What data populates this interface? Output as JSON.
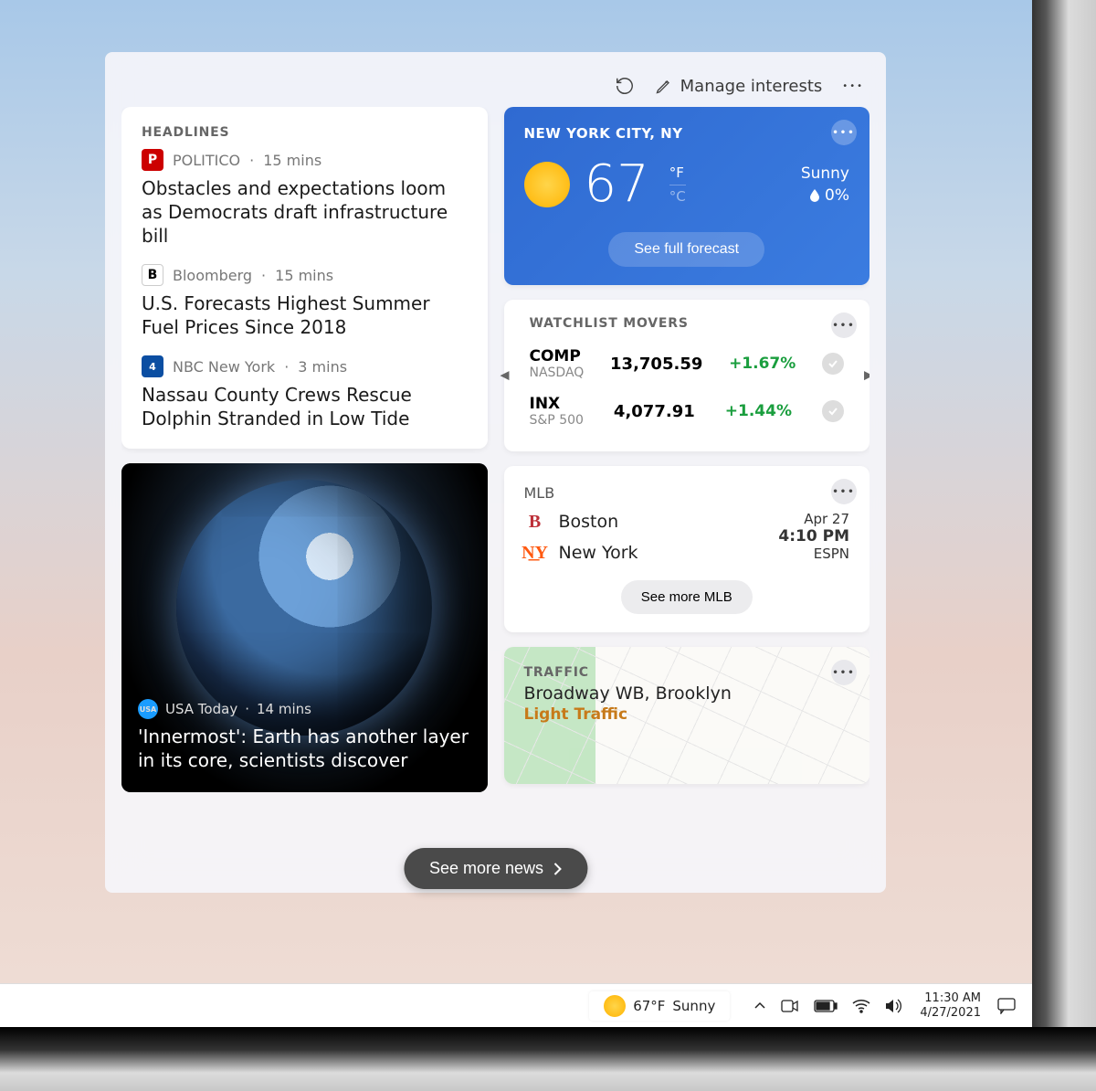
{
  "header": {
    "manage_label": "Manage interests"
  },
  "headlines": {
    "title": "HEADLINES",
    "items": [
      {
        "source": "POLITICO",
        "time": "15 mins",
        "icon_bg": "#cc0000",
        "icon_txt": "P",
        "title": "Obstacles and expectations loom as Democrats draft infrastructure bill"
      },
      {
        "source": "Bloomberg",
        "time": "15 mins",
        "icon_bg": "#ffffff",
        "icon_txt": "B",
        "title": "U.S. Forecasts Highest Summer Fuel Prices Since 2018"
      },
      {
        "source": "NBC New York",
        "time": "3 mins",
        "icon_bg": "#0b4ea2",
        "icon_txt": "4",
        "title": "Nassau County Crews Rescue Dolphin Stranded in Low Tide"
      }
    ]
  },
  "image_story": {
    "source": "USA Today",
    "time": "14 mins",
    "title": "'Innermost': Earth has another layer in its core, scientists discover"
  },
  "weather": {
    "location": "NEW YORK CITY, NY",
    "temp": "67",
    "unit_f": "°F",
    "unit_c": "°C",
    "condition": "Sunny",
    "humidity": "0%",
    "forecast_btn": "See full forecast"
  },
  "watchlist": {
    "title": "WATCHLIST MOVERS",
    "rows": [
      {
        "symbol": "COMP",
        "index": "NASDAQ",
        "price": "13,705.59",
        "change": "+1.67%"
      },
      {
        "symbol": "INX",
        "index": "S&P 500",
        "price": "4,077.91",
        "change": "+1.44%"
      }
    ]
  },
  "mlb": {
    "title": "MLB",
    "teams": [
      {
        "name": "Boston",
        "logo": "B",
        "color": "#bd3039"
      },
      {
        "name": "New York",
        "logo": "N͟Y",
        "color": "#ff5910"
      }
    ],
    "date": "Apr 27",
    "time": "4:10 PM",
    "network": "ESPN",
    "see_more": "See more MLB"
  },
  "traffic": {
    "title": "TRAFFIC",
    "location": "Broadway WB, Brooklyn",
    "status": "Light Traffic"
  },
  "see_more_news": "See more news",
  "taskbar": {
    "temp": "67°F",
    "condition": "Sunny",
    "time": "11:30 AM",
    "date": "4/27/2021"
  }
}
